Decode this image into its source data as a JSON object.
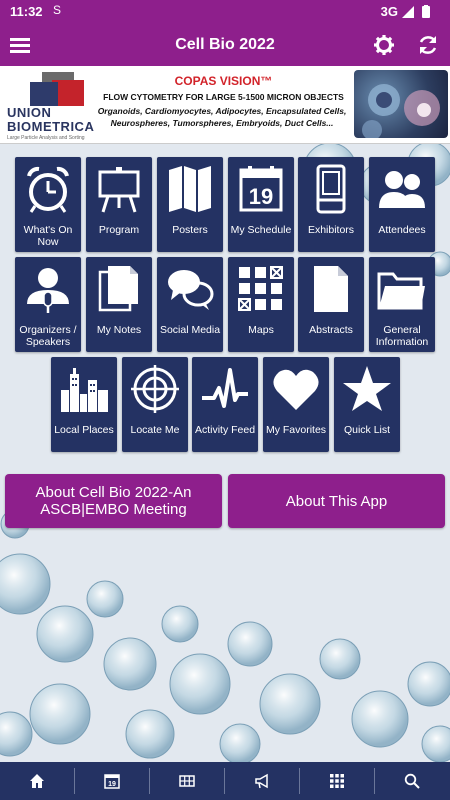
{
  "status_bar": {
    "time": "11:32",
    "sim_icon": "S",
    "network": "3G"
  },
  "header": {
    "title": "Cell Bio 2022"
  },
  "banner": {
    "logo_line1": "UNION",
    "logo_line2": "BIOMETRICA",
    "logo_tagline": "Large Particle Analysis and Sorting",
    "title": "COPAS VISION™",
    "subtitle": "FLOW CYTOMETRY FOR LARGE 5-1500  MICRON OBJECTS",
    "description": "Organoids, Cardiomyocytes, Adipocytes, Encapsulated Cells, Neurospheres, Tumorspheres, Embryoids, Duct Cells..."
  },
  "tiles": [
    {
      "label": "What's On Now",
      "icon": "alarm-clock-icon"
    },
    {
      "label": "Program",
      "icon": "easel-icon"
    },
    {
      "label": "Posters",
      "icon": "map-folds-icon"
    },
    {
      "label": "My Schedule",
      "icon": "calendar-icon",
      "icon_text": "19"
    },
    {
      "label": "Exhibitors",
      "icon": "booth-icon"
    },
    {
      "label": "Attendees",
      "icon": "people-icon"
    },
    {
      "label": "Organizers / Speakers",
      "icon": "speaker-icon"
    },
    {
      "label": "My Notes",
      "icon": "notes-icon"
    },
    {
      "label": "Social Media",
      "icon": "chat-bubbles-icon"
    },
    {
      "label": "Maps",
      "icon": "floorplan-icon"
    },
    {
      "label": "Abstracts",
      "icon": "document-icon"
    },
    {
      "label": "General Information",
      "icon": "folder-icon"
    },
    {
      "label": "Local Places",
      "icon": "city-icon"
    },
    {
      "label": "Locate Me",
      "icon": "crosshair-icon"
    },
    {
      "label": "Activity Feed",
      "icon": "pulse-icon"
    },
    {
      "label": "My Favorites",
      "icon": "heart-icon"
    },
    {
      "label": "Quick List",
      "icon": "star-icon"
    }
  ],
  "buttons": {
    "about_meeting": "About Cell Bio 2022-An ASCB|EMBO Meeting",
    "about_app": "About This App"
  },
  "bottom_nav": {
    "items": [
      "home-icon",
      "calendar-icon",
      "grid-icon",
      "megaphone-icon",
      "apps-icon",
      "search-icon"
    ],
    "calendar_text": "19"
  },
  "colors": {
    "primary": "#8e1f8c",
    "tile": "#243263",
    "banner_red": "#d2232a"
  }
}
